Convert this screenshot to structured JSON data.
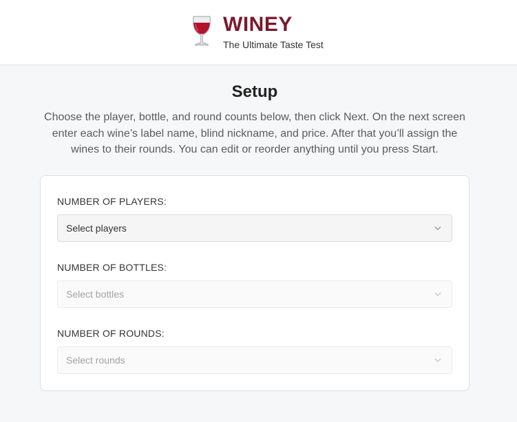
{
  "header": {
    "logo_icon": "wine-glass-icon",
    "title": "WINEY",
    "tagline": "The Ultimate Taste Test",
    "brand_color": "#7a1a2e"
  },
  "main": {
    "title": "Setup",
    "intro_line1": "Choose the player, bottle, and round counts below, then click Next. On the next screen",
    "intro_line2": "enter each wine’s label name, blind nickname, and price. After that you’ll assign the",
    "intro_line3": "wines to their rounds. You can edit or reorder anything until you press Start."
  },
  "form": {
    "players": {
      "label": "NUMBER OF PLAYERS:",
      "placeholder": "Select players",
      "enabled": true
    },
    "bottles": {
      "label": "NUMBER OF BOTTLES:",
      "placeholder": "Select bottles",
      "enabled": false
    },
    "rounds": {
      "label": "NUMBER OF ROUNDS:",
      "placeholder": "Select rounds",
      "enabled": false
    }
  }
}
